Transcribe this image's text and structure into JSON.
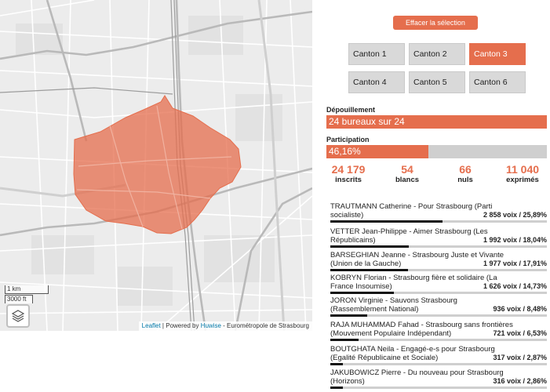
{
  "map": {
    "attribution_leaflet": "Leaflet",
    "attribution_sep": " | Powered by ",
    "attribution_huwise": "Huwise",
    "attribution_rest": " - Eurométropole de Strasbourg",
    "scale_km": "1 km",
    "scale_ft": "3000 ft",
    "highlight_color": "#e56e4d",
    "layers_icon": "layers-icon"
  },
  "panel": {
    "clear_button": "Effacer la sélection",
    "cantons": [
      {
        "label": "Canton 1",
        "active": false
      },
      {
        "label": "Canton 2",
        "active": false
      },
      {
        "label": "Canton 3",
        "active": true
      },
      {
        "label": "Canton 4",
        "active": false
      },
      {
        "label": "Canton 5",
        "active": false
      },
      {
        "label": "Canton 6",
        "active": false
      }
    ],
    "depouillement": {
      "title": "Dépouillement",
      "text": "24 bureaux sur 24",
      "fraction": 1.0
    },
    "participation": {
      "title": "Participation",
      "text": "46,16%",
      "fraction": 0.4616
    },
    "stats": [
      {
        "num": "24 179",
        "label": "inscrits"
      },
      {
        "num": "54",
        "label": "blancs"
      },
      {
        "num": "66",
        "label": "nuls"
      },
      {
        "num": "11 040",
        "label": "exprimés"
      }
    ],
    "candidates": [
      {
        "line1": "TRAUTMANN Catherine - Pour Strasbourg (Parti",
        "line2": "socialiste)",
        "result": "2 858 voix /  25,89%",
        "pct": 25.89
      },
      {
        "line1": "VETTER Jean-Philippe - Aimer Strasbourg (Les",
        "line2": "Républicains)",
        "result": "1 992 voix /  18,04%",
        "pct": 18.04
      },
      {
        "line1": "BARSEGHIAN Jeanne - Strasbourg Juste et Vivante",
        "line2": "(Union de la Gauche)",
        "result": "1 977 voix /  17,91%",
        "pct": 17.91
      },
      {
        "line1": "KOBRYN Florian - Strasbourg fière et solidaire (La",
        "line2": "France Insoumise)",
        "result": "1 626 voix /  14,73%",
        "pct": 14.73
      },
      {
        "line1": "JORON Virginie - Sauvons Strasbourg",
        "line2": "(Rassemblement National)",
        "result": "936 voix /  8,48%",
        "pct": 8.48
      },
      {
        "line1": "RAJA MUHAMMAD Fahad - Strasbourg sans frontières",
        "line2": "(Mouvement Populaire Indépendant)",
        "result": "721 voix /  6,53%",
        "pct": 6.53
      },
      {
        "line1": "BOUTGHATA Neila - Engagé-e-s pour Strasbourg",
        "line2": "(Egalité Républicaine et Sociale)",
        "result": "317 voix /  2,87%",
        "pct": 2.87
      },
      {
        "line1": "JAKUBOWICZ Pierre - Du nouveau pour Strasbourg",
        "line2": "(Horizons)",
        "result": "316 voix /  2,86%",
        "pct": 2.86
      }
    ]
  }
}
